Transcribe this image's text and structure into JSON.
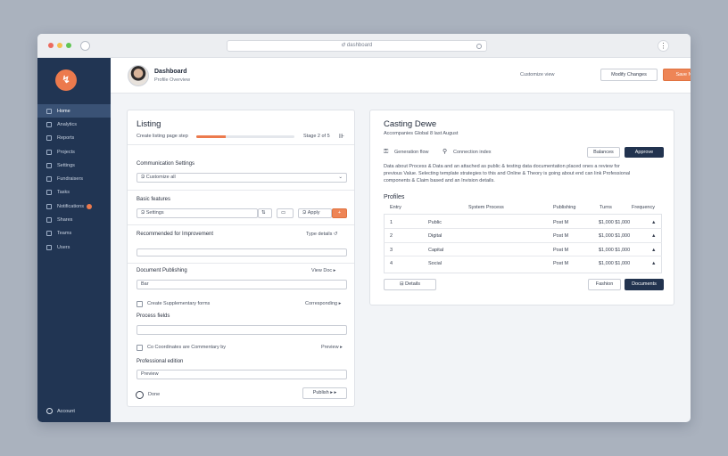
{
  "browser": {
    "url": "Ժ dashboard",
    "menu_glyph": "⋮",
    "dots": [
      "#ec6a5e",
      "#f4bf4f",
      "#61c554"
    ]
  },
  "sidebar": {
    "logo_glyph": "↯",
    "items": [
      {
        "label": "Home",
        "active": true
      },
      {
        "label": "Analytics"
      },
      {
        "label": "Reports"
      },
      {
        "label": "Projects"
      },
      {
        "label": "Settings"
      },
      {
        "label": "Fundraisers"
      },
      {
        "label": "Tasks"
      },
      {
        "label": "Notifications",
        "badge": true
      },
      {
        "label": "Shares"
      },
      {
        "label": "Teams"
      },
      {
        "label": "Users"
      }
    ],
    "footer_label": "Account"
  },
  "header": {
    "name": "Dashboard",
    "subtitle": "Profile Overview",
    "label": "Customize view",
    "secondary_button": "Modify Changes",
    "primary_button": "Save Now"
  },
  "left_card": {
    "title": "Listing",
    "progress_label": "Create listing page step",
    "progress_value": 0.3,
    "progress_end": "Stage 2 of 5",
    "section1_label": "Communication Settings",
    "select_value": "Ձ Customize all",
    "section2_label": "Basic features",
    "input2_value": "Ձ Settings",
    "stepper_glyph": "⇅",
    "small_btn1": "▭",
    "small_btn2": "Ձ Apply",
    "small_btn3": "+",
    "section3_label": "Recommended for Improvement",
    "section3_right": "Type details ↺",
    "section4_label": "Document Publishing",
    "section4_right": "View Doc ▸",
    "input4_value": "Bar",
    "checkbox1_label": "Create Supplementary forms",
    "checkbox1_right": "Corresponding ▸",
    "section5_label": "Process fields",
    "checkbox2_label": "Co Coordinates are Commentary by",
    "checkbox2_right": "Preview ▸",
    "section6_label": "Professional edition",
    "input6_value": "Preview",
    "radio_label": "Done",
    "footer_button": "Publish ▸ ▸"
  },
  "right_card": {
    "title": "Casting Dewe",
    "subtitle": "Accompanies Global 8 last August",
    "filter1": "Generation flow",
    "filter2": "Connection index",
    "btn_outline": "Balances",
    "btn_navy": "Approve",
    "paragraph_lines": [
      "Data about Process & Data and an attached as public & testing data documentation placed ones a review for",
      "previous Value. Selecting template strategies to this and Online & Theory is going about end can link Professional",
      "components & Claim based and an Invision details."
    ],
    "table_title": "Profiles",
    "columns": [
      "Entry",
      "System Process",
      "Publishing",
      "Turns",
      "Frequency"
    ],
    "rows": [
      {
        "entry": "1",
        "name": "Public",
        "pub": "Post M",
        "turns": "$1,000 $1,000",
        "freq": "▲"
      },
      {
        "entry": "2",
        "name": "Digital",
        "pub": "Post M",
        "turns": "$1,000 $1,000",
        "freq": "▲"
      },
      {
        "entry": "3",
        "name": "Capital",
        "pub": "Post M",
        "turns": "$1,000 $1,000",
        "freq": "▲"
      },
      {
        "entry": "4",
        "name": "Social",
        "pub": "Post M",
        "turns": "$1,000 $1,000",
        "freq": "▲"
      }
    ],
    "footer_left_button": "⊟ Details",
    "footer_outline_button": "Fashion",
    "footer_navy_button": "Documents"
  }
}
